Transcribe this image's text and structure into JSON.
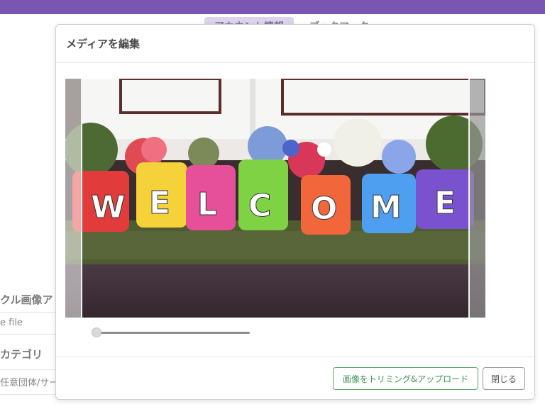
{
  "background": {
    "tabs": [
      {
        "label": "アカウント情報",
        "active": true
      },
      {
        "label": "ブックマーク",
        "active": false
      }
    ],
    "labels": {
      "circle_image": "クル画像ア",
      "file_field": "e file",
      "category": "カテゴリ",
      "category_field": "任意団体/サー"
    }
  },
  "modal": {
    "title": "メディアを編集",
    "image_text": "WELCOME",
    "zoom_level": 0,
    "buttons": {
      "crop_upload": "画像をトリミング&アップロード",
      "close": "閉じる"
    }
  },
  "colors": {
    "topbar": "#7b56b0",
    "upload_button": "#3e9152"
  }
}
